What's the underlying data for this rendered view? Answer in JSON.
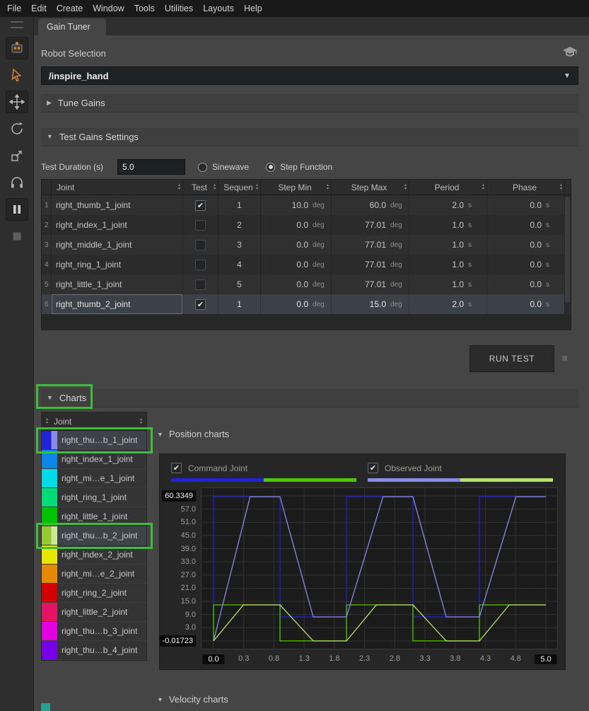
{
  "menu": {
    "items": [
      "File",
      "Edit",
      "Create",
      "Window",
      "Tools",
      "Utilities",
      "Layouts",
      "Help"
    ]
  },
  "toolbar": {
    "icons": [
      "menu-handle-icon",
      "robot-tool-icon",
      "select-cursor-icon",
      "move-tool-icon",
      "rotate-tool-icon",
      "scale-tool-icon",
      "audio-tool-icon",
      "pause-tool-icon",
      "stop-tool-icon"
    ]
  },
  "tab": {
    "label": "Gain Tuner"
  },
  "robot_selection": {
    "label": "Robot Selection",
    "value": "/inspire_hand"
  },
  "sections": {
    "tune_gains": "Tune Gains",
    "test_gains": "Test Gains Settings",
    "charts": "Charts",
    "position_charts": "Position charts",
    "velocity_charts": "Velocity charts"
  },
  "test_settings": {
    "duration_label": "Test Duration (s)",
    "duration_value": "5.0",
    "waveform_options": [
      {
        "label": "Sinewave",
        "selected": false
      },
      {
        "label": "Step Function",
        "selected": true
      }
    ],
    "run_button": "RUN TEST",
    "table": {
      "columns": [
        "Joint",
        "Test",
        "Sequen",
        "Step Min",
        "Step Max",
        "Period",
        "Phase"
      ],
      "unit_angle": "deg",
      "unit_time": "s",
      "rows": [
        {
          "num": "1",
          "joint": "right_thumb_1_joint",
          "test": true,
          "sequence": "1",
          "step_min": "10.0",
          "step_max": "60.0",
          "period": "2.0",
          "phase": "0.0",
          "selected": false
        },
        {
          "num": "2",
          "joint": "right_index_1_joint",
          "test": false,
          "sequence": "2",
          "step_min": "0.0",
          "step_max": "77.01",
          "period": "1.0",
          "phase": "0.0",
          "selected": false
        },
        {
          "num": "3",
          "joint": "right_middle_1_joint",
          "test": false,
          "sequence": "3",
          "step_min": "0.0",
          "step_max": "77.01",
          "period": "1.0",
          "phase": "0.0",
          "selected": false
        },
        {
          "num": "4",
          "joint": "right_ring_1_joint",
          "test": false,
          "sequence": "4",
          "step_min": "0.0",
          "step_max": "77.01",
          "period": "1.0",
          "phase": "0.0",
          "selected": false
        },
        {
          "num": "5",
          "joint": "right_little_1_joint",
          "test": false,
          "sequence": "5",
          "step_min": "0.0",
          "step_max": "77.01",
          "period": "1.0",
          "phase": "0.0",
          "selected": false
        },
        {
          "num": "6",
          "joint": "right_thumb_2_joint",
          "test": true,
          "sequence": "1",
          "step_min": "0.0",
          "step_max": "15.0",
          "period": "2.0",
          "phase": "0.0",
          "selected": true
        }
      ]
    }
  },
  "joint_list": {
    "header": "Joint",
    "rows": [
      {
        "label": "right_thu…b_1_joint",
        "color": "#2222d8",
        "color2": "#8a8ae8",
        "selected": true
      },
      {
        "label": "right_index_1_joint",
        "color": "#0b86e6"
      },
      {
        "label": "right_mi…e_1_joint",
        "color": "#00dce6"
      },
      {
        "label": "right_ring_1_joint",
        "color": "#00dc78"
      },
      {
        "label": "right_little_1_joint",
        "color": "#00c300"
      },
      {
        "label": "right_thu…b_2_joint",
        "color": "#97c832",
        "color2": "#cce88e",
        "selected": true
      },
      {
        "label": "right_index_2_joint",
        "color": "#e6e600"
      },
      {
        "label": "right_mi…e_2_joint",
        "color": "#e68900"
      },
      {
        "label": "right_ring_2_joint",
        "color": "#d40000"
      },
      {
        "label": "right_little_2_joint",
        "color": "#e61263"
      },
      {
        "label": "right_thu…b_3_joint",
        "color": "#e300e3"
      },
      {
        "label": "right_thu…b_4_joint",
        "color": "#7700e6"
      }
    ]
  },
  "charts_panel": {
    "legend": [
      {
        "label": "Command Joint",
        "checked": true,
        "colors": [
          "#2222d8",
          "#4ec800"
        ]
      },
      {
        "label": "Observed Joint",
        "checked": true,
        "colors": [
          "#8a8ae8",
          "#b4e06e"
        ]
      }
    ]
  },
  "chart_data": {
    "type": "line",
    "title": "Position charts",
    "xlabel": "",
    "ylabel": "",
    "xlim": [
      0,
      5.0
    ],
    "ylim": [
      -0.01723,
      60.3349
    ],
    "grid": true,
    "x_ticks": [
      "0.0",
      "0.3",
      "0.8",
      "1.3",
      "1.8",
      "2.3",
      "2.8",
      "3.3",
      "3.8",
      "4.3",
      "4.8",
      "5.0"
    ],
    "y_ticks": [
      "60.3349",
      "57.0",
      "51.0",
      "45.0",
      "39.0",
      "33.0",
      "27.0",
      "21.0",
      "15.0",
      "9.0",
      "3.0",
      "-0.01723"
    ],
    "series": [
      {
        "name": "command right_thumb_1_joint",
        "color": "#2222d8",
        "points": [
          [
            0,
            10
          ],
          [
            0,
            60
          ],
          [
            1,
            60
          ],
          [
            1,
            10
          ],
          [
            2,
            10
          ],
          [
            2,
            60
          ],
          [
            3,
            60
          ],
          [
            3,
            10
          ],
          [
            4,
            10
          ],
          [
            4,
            60
          ],
          [
            5,
            60
          ]
        ]
      },
      {
        "name": "command right_thumb_2_joint",
        "color": "#4ec800",
        "points": [
          [
            0,
            0
          ],
          [
            0,
            15
          ],
          [
            1,
            15
          ],
          [
            1,
            0
          ],
          [
            2,
            0
          ],
          [
            2,
            15
          ],
          [
            3,
            15
          ],
          [
            3,
            0
          ],
          [
            4,
            0
          ],
          [
            4,
            15
          ],
          [
            5,
            15
          ]
        ]
      },
      {
        "name": "observed right_thumb_1_joint",
        "color": "#8a8ae8",
        "points": [
          [
            0,
            0
          ],
          [
            0.55,
            60
          ],
          [
            1,
            60
          ],
          [
            1.5,
            10
          ],
          [
            2,
            10
          ],
          [
            2.55,
            60
          ],
          [
            3,
            60
          ],
          [
            3.5,
            10
          ],
          [
            4,
            10
          ],
          [
            4.55,
            60
          ],
          [
            5,
            60
          ]
        ]
      },
      {
        "name": "observed right_thumb_2_joint",
        "color": "#b4e06e",
        "points": [
          [
            0,
            0
          ],
          [
            0.45,
            15
          ],
          [
            1,
            15
          ],
          [
            1.5,
            -0.017
          ],
          [
            2,
            -0.017
          ],
          [
            2.45,
            15
          ],
          [
            3,
            15
          ],
          [
            3.5,
            -0.017
          ],
          [
            4,
            -0.017
          ],
          [
            4.45,
            15
          ],
          [
            5,
            15
          ]
        ]
      }
    ]
  },
  "annotations": {
    "color": "#3ebc3e",
    "boxes": [
      "charts-section",
      "joint-row-1",
      "joint-row-6"
    ]
  },
  "misc": {
    "corner_swatch_color": "#2aa190"
  }
}
